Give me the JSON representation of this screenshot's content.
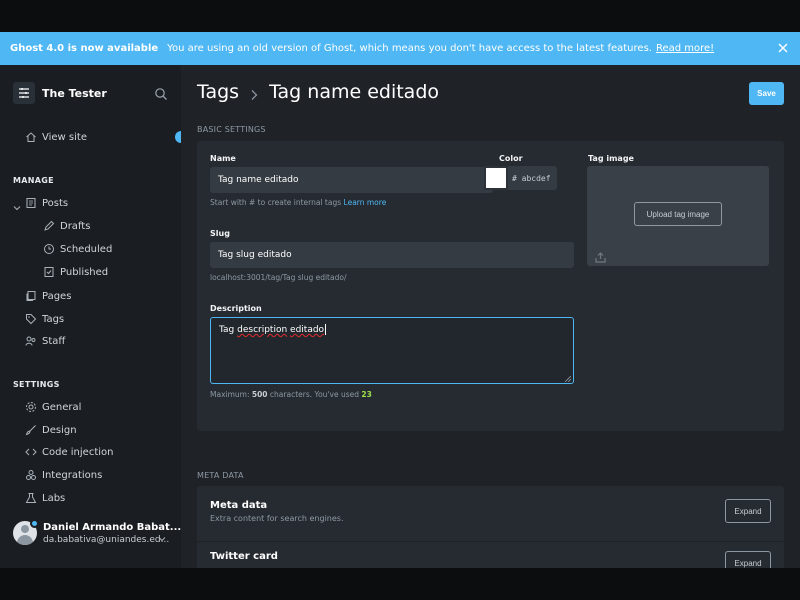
{
  "banner": {
    "title": "Ghost 4.0 is now available",
    "message": "You are using an old version of Ghost, which means you don't have access to the latest features.",
    "link": "Read more!"
  },
  "sidebar": {
    "site_title": "The Tester",
    "view_site": "View site",
    "manage_title": "MANAGE",
    "manage_items": {
      "posts": "Posts",
      "drafts": "Drafts",
      "scheduled": "Scheduled",
      "published": "Published",
      "pages": "Pages",
      "tags": "Tags",
      "staff": "Staff"
    },
    "settings_title": "SETTINGS",
    "settings_items": {
      "general": "General",
      "design": "Design",
      "code_injection": "Code injection",
      "integrations": "Integrations",
      "labs": "Labs"
    },
    "user": {
      "name": "Daniel Armando Babat...",
      "email": "da.babativa@uniandes.ed..."
    }
  },
  "main": {
    "breadcrumb_root": "Tags",
    "breadcrumb_current": "Tag name editado",
    "save_label": "Save",
    "basic_settings_title": "BASIC SETTINGS",
    "name_label": "Name",
    "name_value": "Tag name editado",
    "name_hint_prefix": "Start with # to create internal tags",
    "name_hint_link": "Learn more",
    "color_label": "Color",
    "color_value": "# abcdef",
    "swatch_color": "#ffffff",
    "tag_image_label": "Tag image",
    "upload_label": "Upload tag image",
    "slug_label": "Slug",
    "slug_value": "Tag slug editado",
    "slug_url": "localhost:3001/tag/Tag slug editado/",
    "description_label": "Description",
    "description_word_1": "Tag",
    "description_word_2": "description",
    "description_word_3": "editado",
    "desc_hint_prefix": "Maximum:",
    "desc_hint_max": "500",
    "desc_hint_mid": "characters. You've used",
    "desc_hint_used": "23",
    "meta_section_title": "META DATA",
    "meta_data_title": "Meta data",
    "meta_data_sub": "Extra content for search engines.",
    "twitter_title": "Twitter card",
    "expand_label": "Expand"
  },
  "colors": {
    "accent": "#4fb7f3",
    "sidebar_bg": "#1a1e22",
    "main_bg": "#1f2328",
    "card_bg": "#262b31"
  }
}
